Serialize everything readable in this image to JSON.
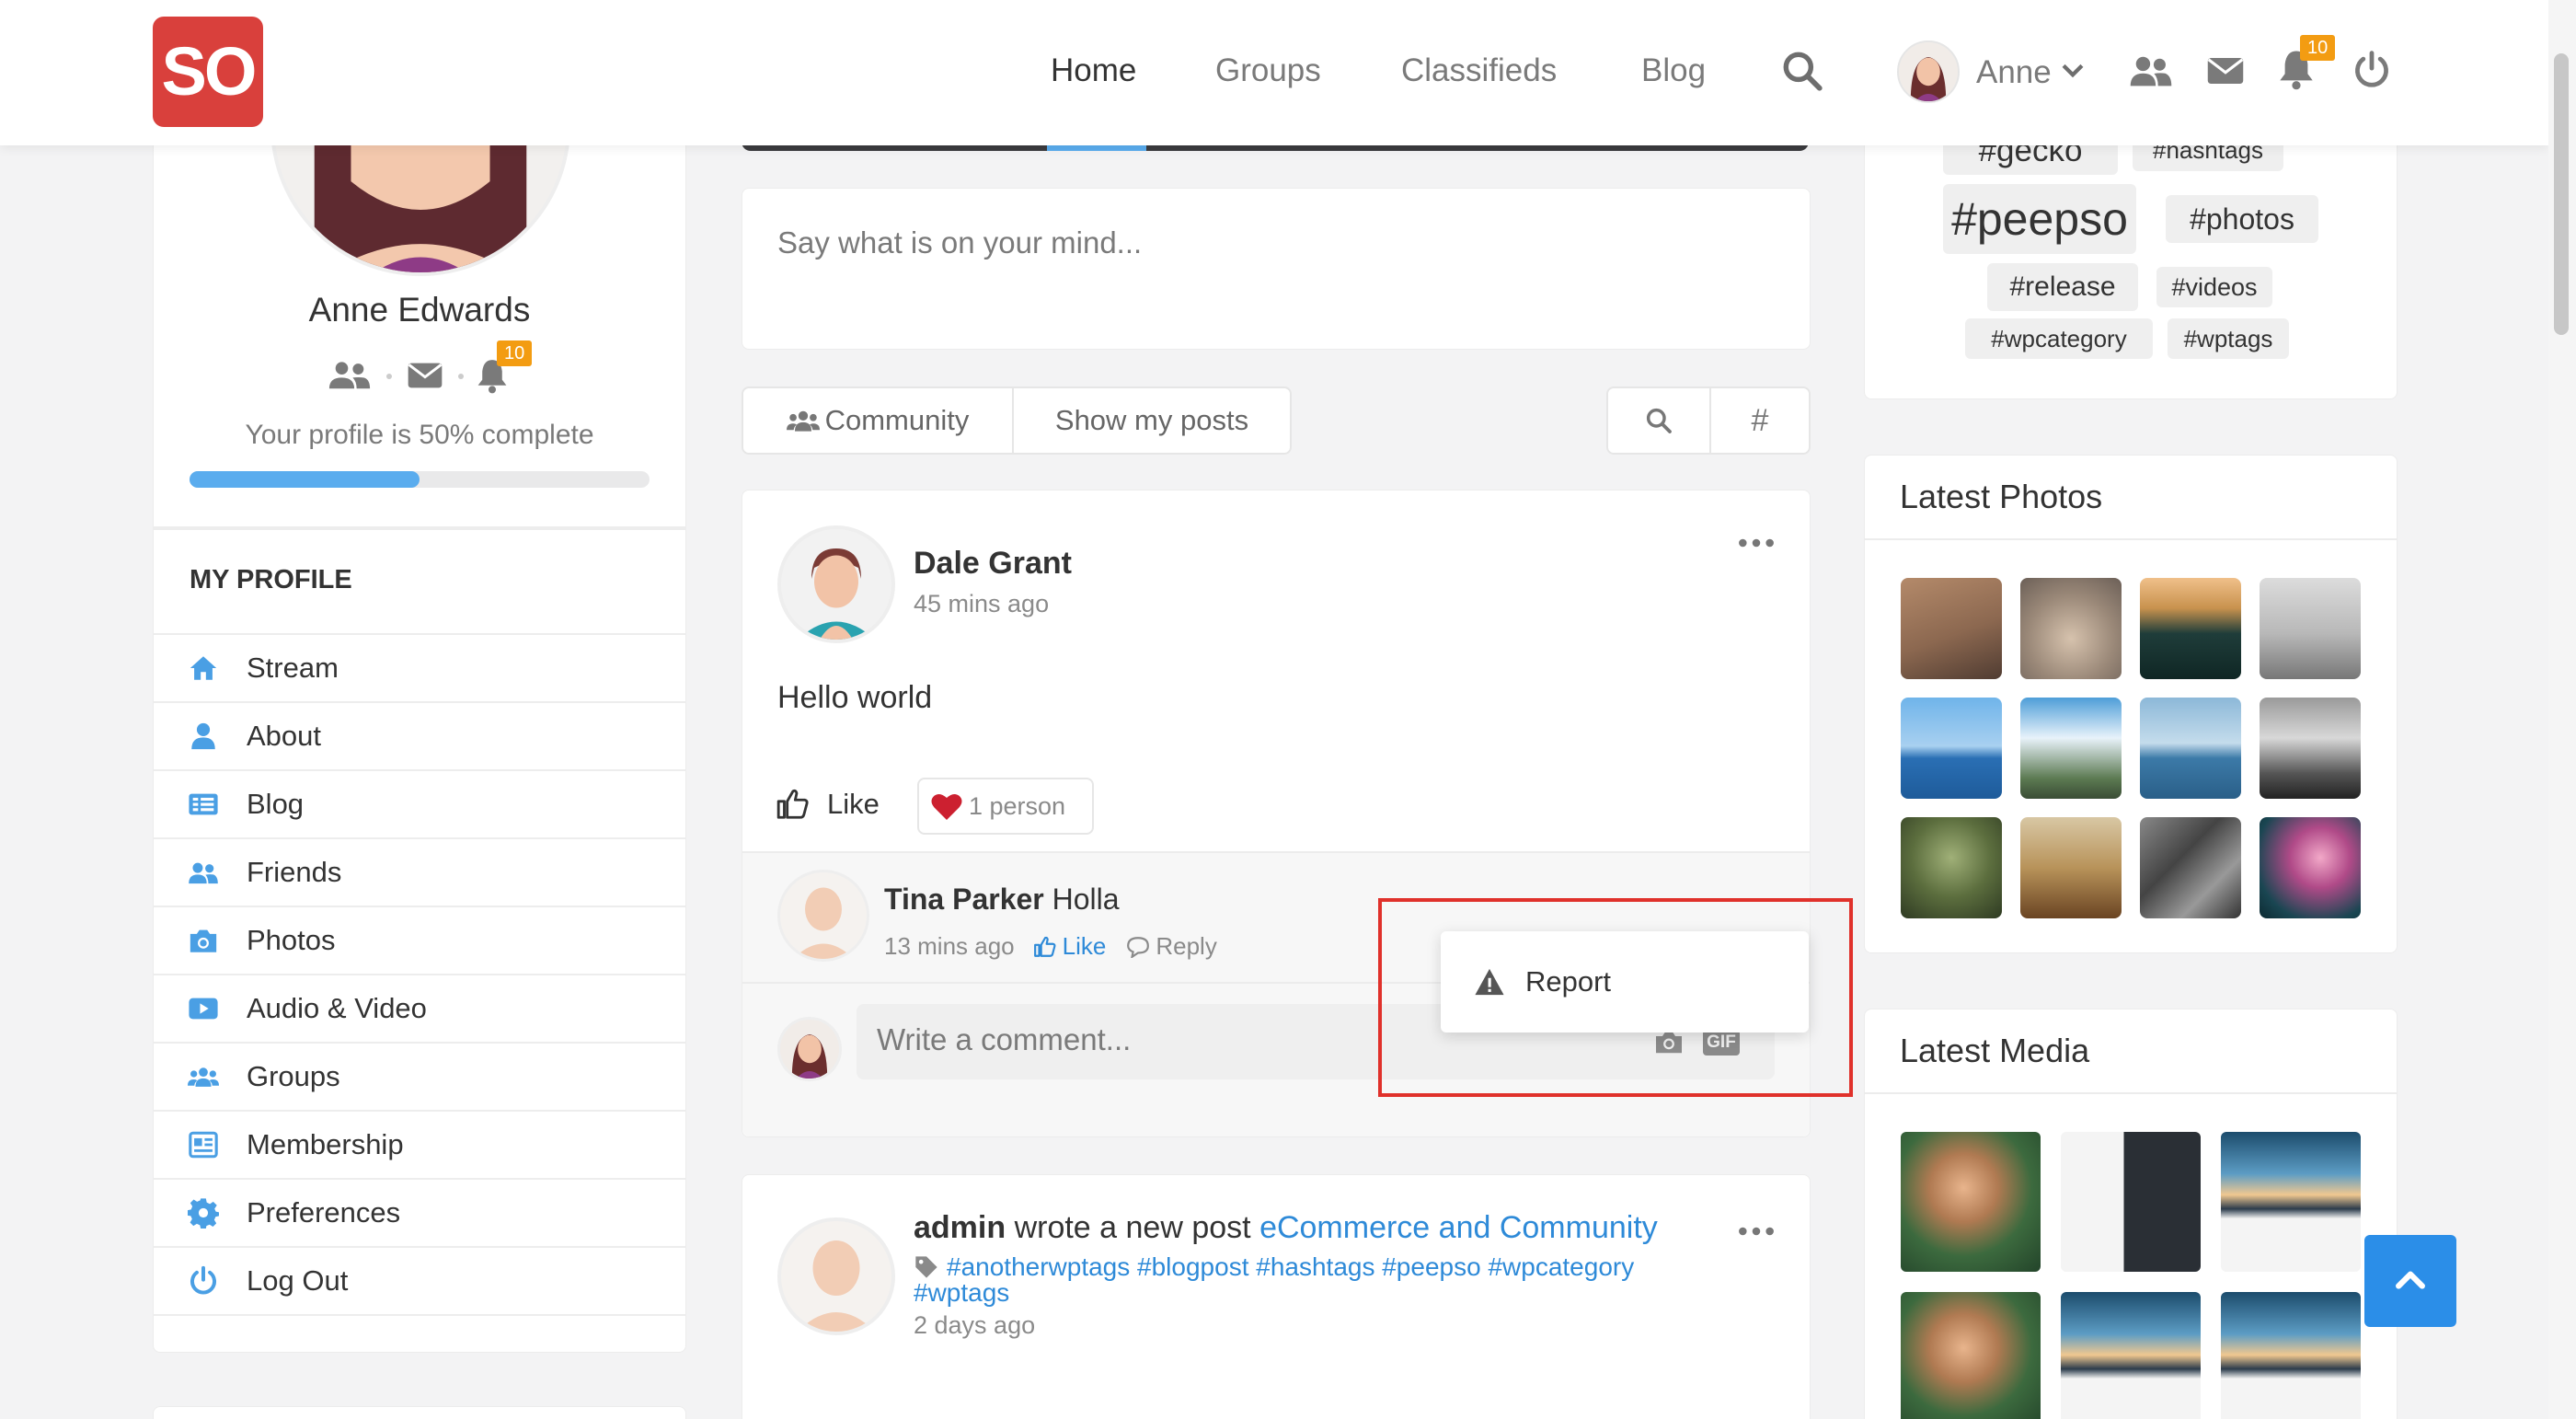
{
  "header": {
    "logo_text": "SO",
    "nav": [
      {
        "label": "Home",
        "active": true
      },
      {
        "label": "Groups"
      },
      {
        "label": "Classifieds"
      },
      {
        "label": "Blog"
      }
    ],
    "user_name": "Anne",
    "notification_count": "10"
  },
  "profile": {
    "name": "Anne Edwards",
    "notification_count": "10",
    "completion_text": "Your profile is 50% complete",
    "completion_fraction": 0.5,
    "menu_title": "MY PROFILE",
    "menu": [
      {
        "label": "Stream",
        "icon": "home-icon"
      },
      {
        "label": "About",
        "icon": "user-icon"
      },
      {
        "label": "Blog",
        "icon": "list-icon"
      },
      {
        "label": "Friends",
        "icon": "users-icon"
      },
      {
        "label": "Photos",
        "icon": "camera-icon"
      },
      {
        "label": "Audio & Video",
        "icon": "video-icon"
      },
      {
        "label": "Groups",
        "icon": "groups-icon"
      },
      {
        "label": "Membership",
        "icon": "id-card-icon"
      },
      {
        "label": "Preferences",
        "icon": "gear-icon"
      },
      {
        "label": "Log Out",
        "icon": "power-icon"
      }
    ]
  },
  "composer": {
    "placeholder": "Say what is on your mind..."
  },
  "filters": {
    "community": "Community",
    "show_my_posts": "Show my posts",
    "hash": "#"
  },
  "post1": {
    "author": "Dale Grant",
    "time": "45 mins ago",
    "body": "Hello world",
    "like_label": "Like",
    "reactions": "1 person",
    "comment": {
      "author": "Tina Parker",
      "text": "Holla",
      "time": "13 mins ago",
      "like": "Like",
      "reply": "Reply"
    },
    "comment_placeholder": "Write a comment...",
    "gif_label": "GIF"
  },
  "dropdown": {
    "report": "Report"
  },
  "post2": {
    "author": "admin",
    "action": "wrote a new post",
    "link": "eCommerce and Community",
    "tags_line1": "#anotherwptags #blogpost #hashtags #peepso #wpcategory",
    "tags_line2": "#wptags",
    "time": "2 days ago"
  },
  "tags": [
    "#gecko",
    "#hashtags",
    "#peepso",
    "#photos",
    "#release",
    "#videos",
    "#wpcategory",
    "#wptags"
  ],
  "latest_photos": {
    "title": "Latest Photos"
  },
  "latest_media": {
    "title": "Latest Media"
  },
  "colors": {
    "brand": "#d9403c",
    "accent": "#2e8ad8",
    "badge": "#f39c12",
    "highlight": "#e0312b"
  }
}
